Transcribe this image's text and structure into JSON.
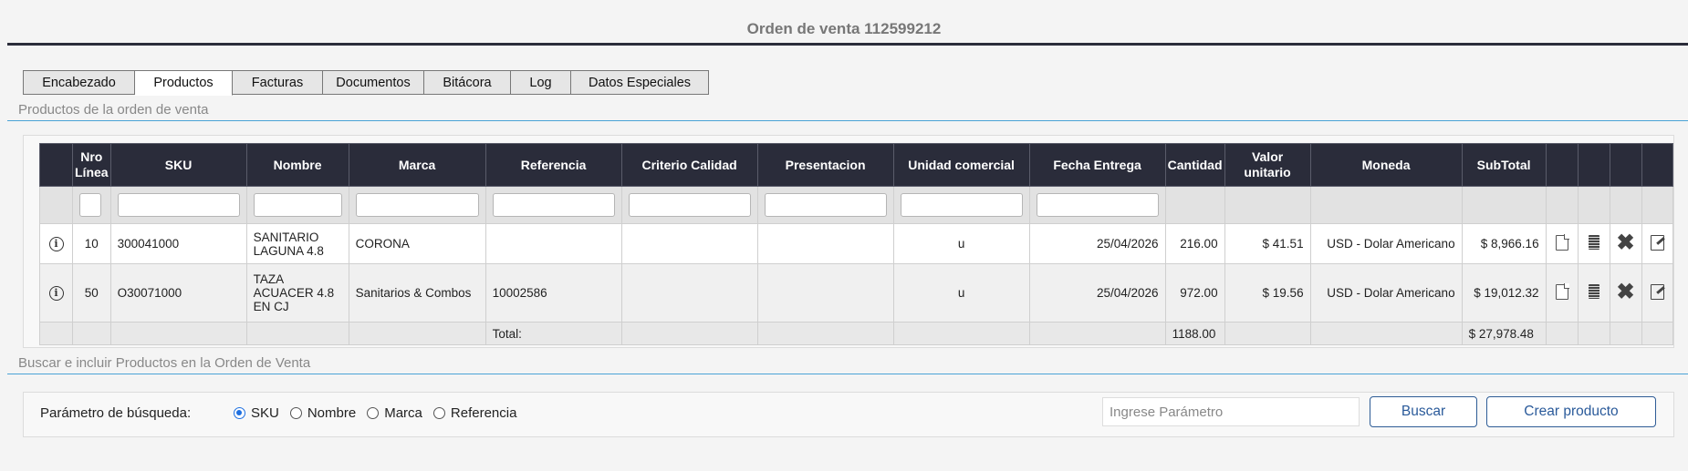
{
  "title": "Orden de venta 112599212",
  "tabs": [
    "Encabezado",
    "Productos",
    "Facturas",
    "Documentos",
    "Bitácora",
    "Log",
    "Datos Especiales"
  ],
  "active_tab": "Productos",
  "section_products": "Productos de la orden de venta",
  "table": {
    "headers": [
      "Nro Línea",
      "SKU",
      "Nombre",
      "Marca",
      "Referencia",
      "Criterio Calidad",
      "Presentacion",
      "Unidad comercial",
      "Fecha Entrega",
      "Cantidad",
      "Valor unitario",
      "Moneda",
      "SubTotal"
    ],
    "rows": [
      {
        "line": "10",
        "sku": "300041000",
        "name": "SANITARIO LAGUNA 4.8",
        "brand": "CORONA",
        "ref": "",
        "quality": "",
        "presentation": "",
        "unit": "u",
        "date": "25/04/2026",
        "qty": "216.00",
        "unit_price": "$ 41.51",
        "currency": "USD - Dolar Americano",
        "subtotal": "$ 8,966.16"
      },
      {
        "line": "50",
        "sku": "O30071000",
        "name": "TAZA ACUACER 4.8 EN CJ",
        "brand": "Sanitarios & Combos",
        "ref": "10002586",
        "quality": "",
        "presentation": "",
        "unit": "u",
        "date": "25/04/2026",
        "qty": "972.00",
        "unit_price": "$ 19.56",
        "currency": "USD - Dolar Americano",
        "subtotal": "$ 19,012.32"
      }
    ],
    "total_label": "Total:",
    "total_qty": "1188.00",
    "total_subtotal": "$ 27,978.48"
  },
  "section_search": "Buscar e incluir Productos en la Orden de Venta",
  "search": {
    "label": "Parámetro de búsqueda:",
    "options": [
      "SKU",
      "Nombre",
      "Marca",
      "Referencia"
    ],
    "selected": "SKU",
    "placeholder": "Ingrese Parámetro",
    "search_button": "Buscar",
    "create_button": "Crear producto"
  },
  "icons": {
    "row_info": "info-icon",
    "row_actions": [
      "document-icon",
      "documents-icon",
      "delete-icon",
      "edit-icon"
    ]
  }
}
